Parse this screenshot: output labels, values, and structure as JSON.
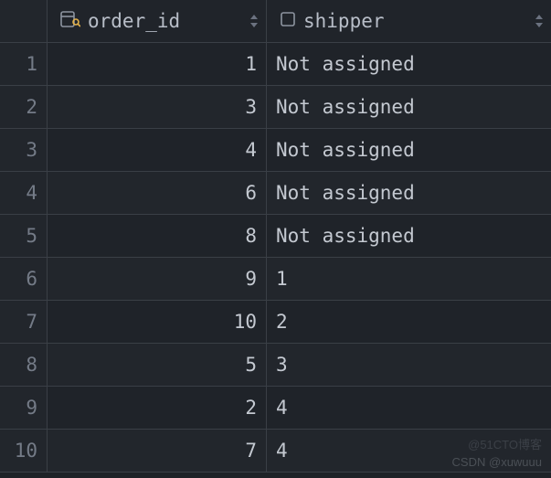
{
  "columns": {
    "order_id": {
      "label": "order_id"
    },
    "shipper": {
      "label": "shipper"
    }
  },
  "rows": [
    {
      "n": "1",
      "order_id": "1",
      "shipper": "Not assigned"
    },
    {
      "n": "2",
      "order_id": "3",
      "shipper": "Not assigned"
    },
    {
      "n": "3",
      "order_id": "4",
      "shipper": "Not assigned"
    },
    {
      "n": "4",
      "order_id": "6",
      "shipper": "Not assigned"
    },
    {
      "n": "5",
      "order_id": "8",
      "shipper": "Not assigned"
    },
    {
      "n": "6",
      "order_id": "9",
      "shipper": "1"
    },
    {
      "n": "7",
      "order_id": "10",
      "shipper": "2"
    },
    {
      "n": "8",
      "order_id": "5",
      "shipper": "3"
    },
    {
      "n": "9",
      "order_id": "2",
      "shipper": "4"
    },
    {
      "n": "10",
      "order_id": "7",
      "shipper": "4"
    }
  ],
  "watermarks": {
    "a": "@51CTO博客",
    "b": "CSDN @xuwuuu"
  }
}
